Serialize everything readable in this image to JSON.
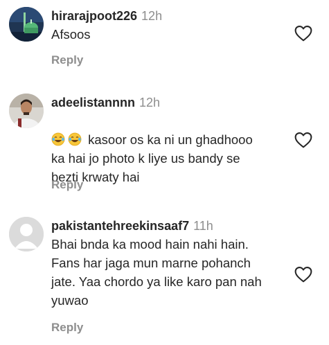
{
  "comments": [
    {
      "username": "hirarajpoot226",
      "time": "12h",
      "text": "Afsoos",
      "reply_label": "Reply",
      "avatar": "green-mosque-photo"
    },
    {
      "username": "adeelistannnn",
      "time": "12h",
      "emojis": [
        "face-with-tears-of-joy",
        "face-with-tears-of-joy"
      ],
      "text": "kasoor os ka ni un ghadhooo\nka hai jo photo k liye us bandy se\nbezti krwaty hai",
      "reply_label": "Reply",
      "avatar": "man-portrait-photo"
    },
    {
      "username": "pakistantehreekinsaaf7",
      "time": "11h",
      "text": "Bhai bnda ka mood hain nahi hain.\nFans har jaga mun marne pohanch\njate. Yaa chordo ya like karo pan nah\nyuwao",
      "reply_label": "Reply",
      "avatar": "default-avatar"
    }
  ],
  "icons": {
    "like": "heart-outline-icon"
  },
  "colors": {
    "text": "#262626",
    "secondary": "#8e8e8e",
    "avatar_placeholder": "#dbdbdb"
  }
}
